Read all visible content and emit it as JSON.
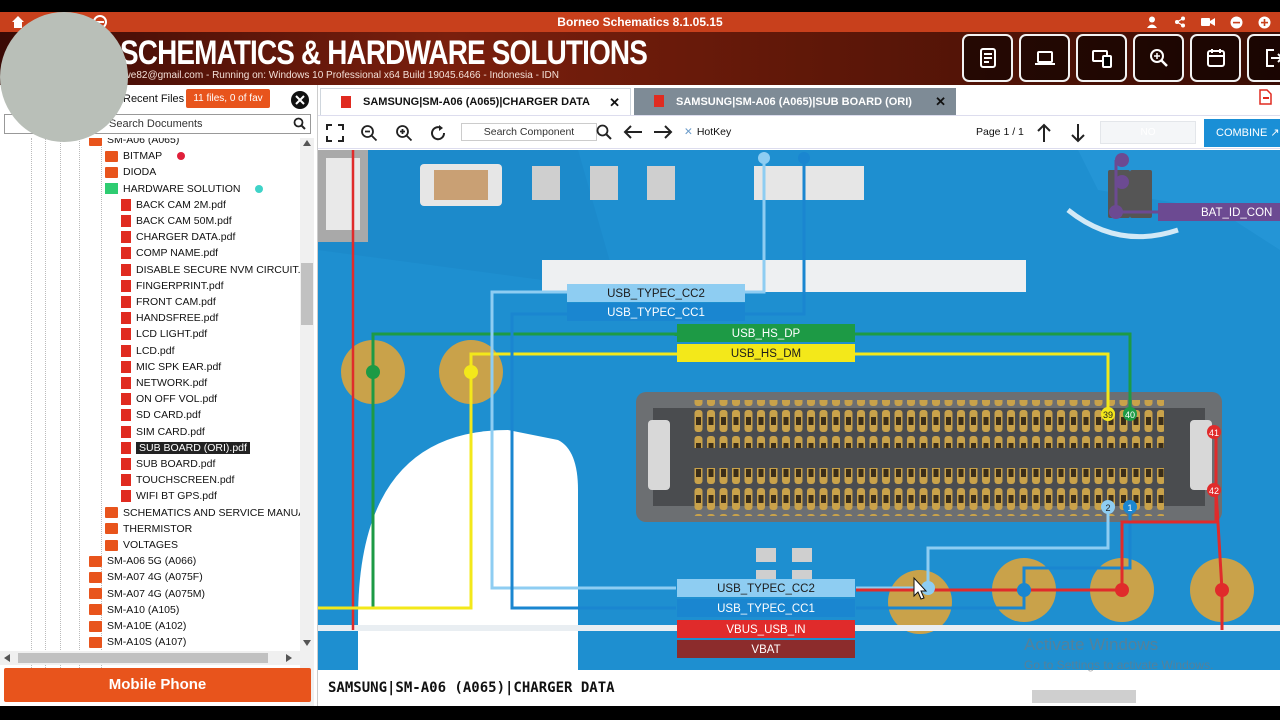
{
  "app": {
    "title": "Borneo Schematics 8.1.05.15"
  },
  "banner": {
    "brand": "SCHEMATICS & HARDWARE SOLUTIONS",
    "info": "nwe82@gmail.com - Running on: Windows 10 Professional x64 Build 19045.6466 - Indonesia - IDN"
  },
  "sidebar": {
    "recent_label": "Recent Files",
    "files_badge": "11 files, 0 of fav",
    "search_placeholder": "Search Documents",
    "mobile_button": "Mobile Phone",
    "tree": [
      {
        "label": "SM-A06 (A065)",
        "kind": "folder",
        "level": 0
      },
      {
        "label": "BITMAP",
        "kind": "folder",
        "level": 1,
        "dot": "#e0203a"
      },
      {
        "label": "DIODA",
        "kind": "folder",
        "level": 1
      },
      {
        "label": "HARDWARE SOLUTION",
        "kind": "folder-green",
        "level": 1,
        "dot": "#3fd3c8"
      },
      {
        "label": "BACK CAM 2M.pdf",
        "kind": "pdf",
        "level": 2
      },
      {
        "label": "BACK CAM 50M.pdf",
        "kind": "pdf",
        "level": 2
      },
      {
        "label": "CHARGER DATA.pdf",
        "kind": "pdf",
        "level": 2
      },
      {
        "label": "COMP NAME.pdf",
        "kind": "pdf",
        "level": 2
      },
      {
        "label": "DISABLE SECURE NVM CIRCUIT.p",
        "kind": "pdf",
        "level": 2
      },
      {
        "label": "FINGERPRINT.pdf",
        "kind": "pdf",
        "level": 2
      },
      {
        "label": "FRONT CAM.pdf",
        "kind": "pdf",
        "level": 2
      },
      {
        "label": "HANDSFREE.pdf",
        "kind": "pdf",
        "level": 2
      },
      {
        "label": "LCD LIGHT.pdf",
        "kind": "pdf",
        "level": 2
      },
      {
        "label": "LCD.pdf",
        "kind": "pdf",
        "level": 2
      },
      {
        "label": "MIC SPK EAR.pdf",
        "kind": "pdf",
        "level": 2
      },
      {
        "label": "NETWORK.pdf",
        "kind": "pdf",
        "level": 2
      },
      {
        "label": "ON OFF VOL.pdf",
        "kind": "pdf",
        "level": 2
      },
      {
        "label": "SD CARD.pdf",
        "kind": "pdf",
        "level": 2
      },
      {
        "label": "SIM CARD.pdf",
        "kind": "pdf",
        "level": 2
      },
      {
        "label": "SUB BOARD (ORI).pdf",
        "kind": "pdf",
        "level": 2,
        "selected": true
      },
      {
        "label": "SUB BOARD.pdf",
        "kind": "pdf",
        "level": 2
      },
      {
        "label": "TOUCHSCREEN.pdf",
        "kind": "pdf",
        "level": 2
      },
      {
        "label": "WIFI BT GPS.pdf",
        "kind": "pdf",
        "level": 2
      },
      {
        "label": "SCHEMATICS AND SERVICE MANUAL",
        "kind": "folder",
        "level": 1
      },
      {
        "label": "THERMISTOR",
        "kind": "folder",
        "level": 1
      },
      {
        "label": "VOLTAGES",
        "kind": "folder",
        "level": 1
      },
      {
        "label": "SM-A06 5G (A066)",
        "kind": "folder",
        "level": 0
      },
      {
        "label": "SM-A07 4G (A075F)",
        "kind": "folder",
        "level": 0
      },
      {
        "label": "SM-A07 4G (A075M)",
        "kind": "folder",
        "level": 0
      },
      {
        "label": "SM-A10 (A105)",
        "kind": "folder",
        "level": 0
      },
      {
        "label": "SM-A10E (A102)",
        "kind": "folder",
        "level": 0
      },
      {
        "label": "SM-A10S (A107)",
        "kind": "folder",
        "level": 0
      }
    ]
  },
  "tabs": [
    {
      "label": "SAMSUNG|SM-A06 (A065)|CHARGER DATA",
      "active": true
    },
    {
      "label": "SAMSUNG|SM-A06 (A065)|SUB BOARD (ORI)",
      "active": false
    }
  ],
  "toolbar": {
    "search_component_placeholder": "Search Component",
    "hotkey_label": "HotKey",
    "page_info": "Page 1 / 1",
    "page_field": "NO",
    "combine_label": "COMBINE"
  },
  "schematic": {
    "signals": {
      "cc2_top": "USB_TYPEC_CC2",
      "cc1_top": "USB_TYPEC_CC1",
      "hs_dp": "USB_HS_DP",
      "hs_dm": "USB_HS_DM",
      "cc2_bottom": "USB_TYPEC_CC2",
      "cc1_bottom": "USB_TYPEC_CC1",
      "vbus": "VBUS_USB_IN",
      "vbat": "VBAT",
      "bat_id": "BAT_ID_CON"
    },
    "pins": {
      "p39": "39",
      "p40": "40",
      "p41": "41",
      "p42": "42",
      "p2": "2",
      "p1": "1"
    },
    "colors": {
      "cc2": "#8ecdf2",
      "cc1": "#1a86d0",
      "dp": "#1d9a45",
      "dm": "#f3e81a",
      "vbus": "#e02b2b",
      "vbat": "#8c2c2c",
      "bat_id": "#6c4a92",
      "board": "#1e8fd0"
    }
  },
  "caption": "SAMSUNG|SM-A06 (A065)|CHARGER DATA",
  "watermark": {
    "line1": "Activate Windows",
    "line2": "Go to Settings to activate Windows."
  },
  "colors": {
    "accent": "#e8541c",
    "titlebar": "#c8401c",
    "combine": "#1a8fd6"
  }
}
